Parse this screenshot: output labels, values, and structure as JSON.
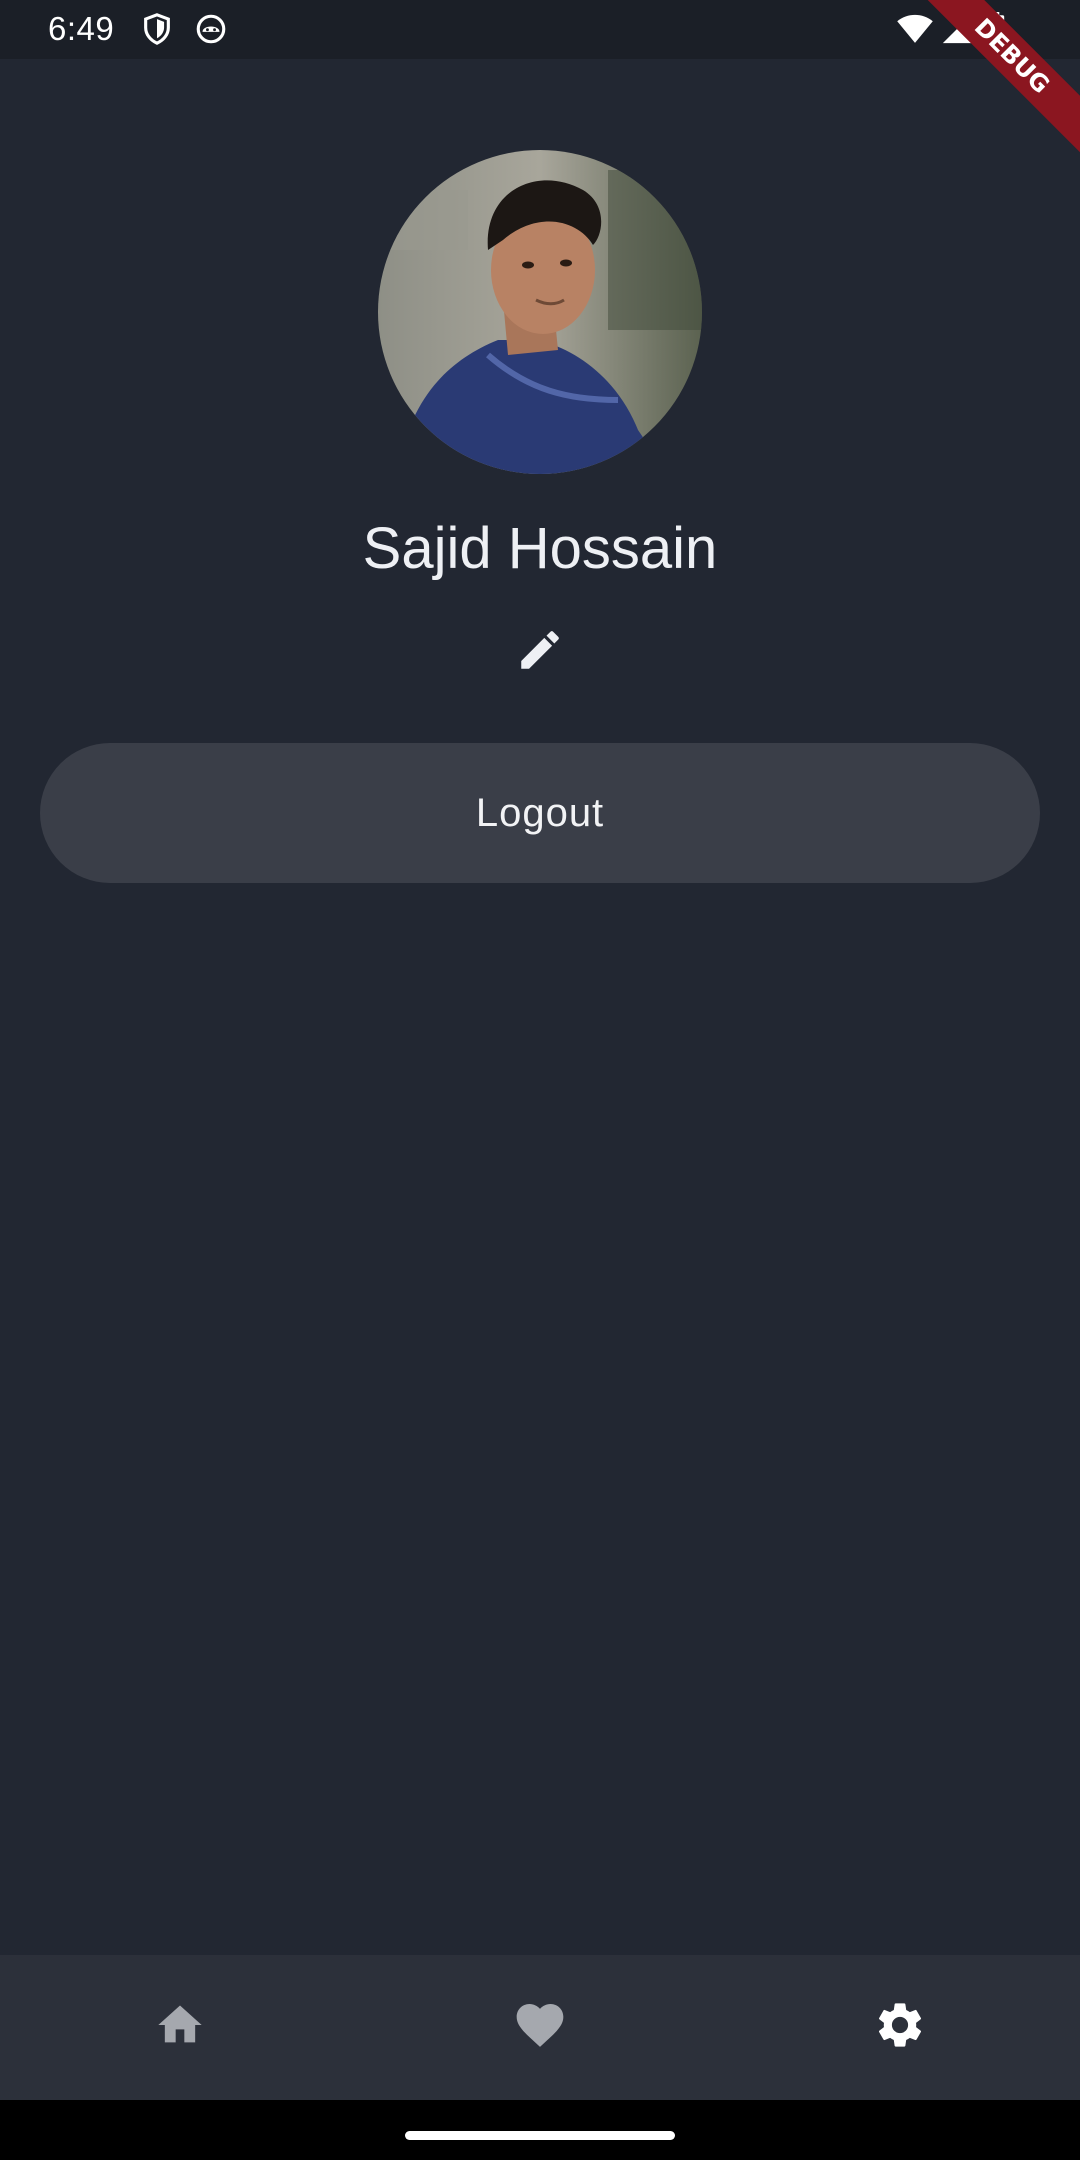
{
  "status_bar": {
    "time": "6:49",
    "left_icons": [
      "shield-icon",
      "android-face-icon"
    ],
    "right_icons": [
      "wifi-icon",
      "cell-signal-icon",
      "battery-icon"
    ]
  },
  "debug_banner": {
    "label": "DEBUG",
    "color": "#8b1620"
  },
  "profile": {
    "name": "Sajid Hossain",
    "avatar": "profile-photo",
    "edit_icon": "pencil-icon"
  },
  "logout_button": {
    "label": "Logout"
  },
  "bottom_nav": {
    "items": [
      {
        "id": "home",
        "icon": "home-icon",
        "active": false
      },
      {
        "id": "favorites",
        "icon": "heart-icon",
        "active": false
      },
      {
        "id": "settings",
        "icon": "gear-icon",
        "active": true
      }
    ]
  },
  "colors": {
    "background": "#222732",
    "status_bar": "#1b1f27",
    "button_bg": "#3a3e48",
    "nav_bg": "#2c303a",
    "nav_icon_inactive": "#a5a8ae",
    "nav_icon_active": "#ffffff"
  }
}
